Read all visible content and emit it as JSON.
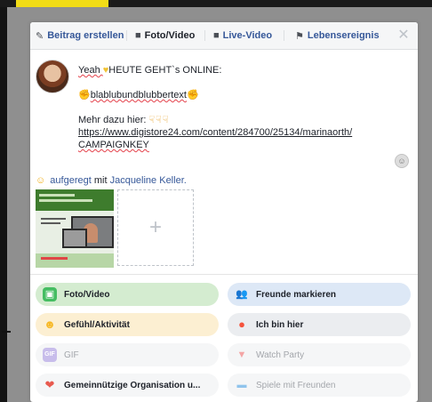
{
  "tabs": [
    {
      "label": "Beitrag erstellen",
      "icon": "pencil-icon"
    },
    {
      "label": "Foto/Video",
      "icon": "camera-icon"
    },
    {
      "label": "Live-Video",
      "icon": "live-video-icon"
    },
    {
      "label": "Lebensereignis",
      "icon": "flag-icon"
    }
  ],
  "post": {
    "line1_a": "Yeah ",
    "line1_b": "HEUTE GEHT`s ONLINE:",
    "line2": "blablubundblubbertext",
    "line3": "Mehr dazu hier: ",
    "link_a": "https://www.digistore24.com/content/284700/25134/marinaorth/",
    "link_b": "CAMPAIGNKEY"
  },
  "feeling": {
    "mood": "aufgeregt",
    "with": "mit",
    "person": "Jacqueline Keller."
  },
  "options": [
    {
      "label": "Foto/Video",
      "icon": "photo-video-icon",
      "bg": "#d4ecd0",
      "color": "#45bd62"
    },
    {
      "label": "Freunde markieren",
      "icon": "tag-friends-icon",
      "bg": "#dde8f6",
      "color": "#1877f2"
    },
    {
      "label": "Gefühl/Aktivität",
      "icon": "feeling-icon",
      "bg": "#fcefd2",
      "color": "#f7b928"
    },
    {
      "label": "Ich bin hier",
      "icon": "location-icon",
      "bg": "#ebedf0",
      "color": "#f5533d"
    },
    {
      "label": "GIF",
      "icon": "gif-icon",
      "bg": "#f5f6f7",
      "color": "#a996d8"
    },
    {
      "label": "Watch Party",
      "icon": "watch-party-icon",
      "bg": "#f5f6f7",
      "color": "#f4a5a5"
    },
    {
      "label": "Gemeinnützige Organisation u...",
      "icon": "fundraiser-icon",
      "bg": "#f5f6f7",
      "color": "#e85a4f"
    },
    {
      "label": "Spiele mit Freunden",
      "icon": "games-icon",
      "bg": "#f5f6f7",
      "color": "#90c4ec"
    }
  ],
  "colors": {
    "link": "#365899",
    "text": "#1d2129"
  }
}
